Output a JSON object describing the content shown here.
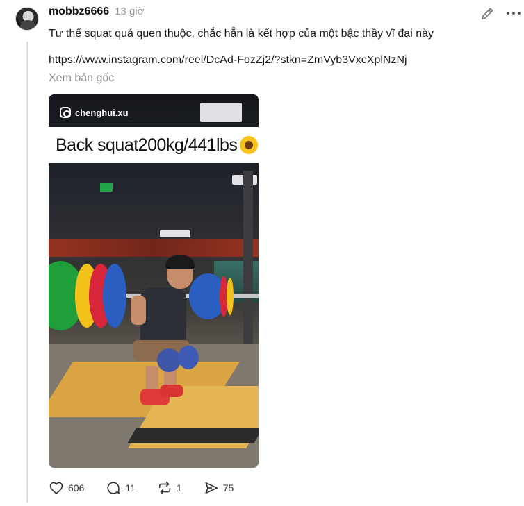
{
  "post": {
    "username": "mobbz6666",
    "time": "13 giờ",
    "text": "Tư thế squat quá quen thuộc, chắc hẳn là kết hợp của một bậc thầy vĩ đại này",
    "link": "https://www.instagram.com/reel/DcAd-FozZj2/?stkn=ZmVyb3VxcXplNzNj",
    "see_original": "Xem bản gốc"
  },
  "media": {
    "handle": "chenghui.xu_",
    "caption": "Back squat200kg/441lbs",
    "caption_emoji": "sunflower-icon"
  },
  "actions": {
    "likes": "606",
    "replies": "11",
    "reposts": "1",
    "shares": "75"
  },
  "icons": {
    "edit": "pencil-icon",
    "more": "more-dots-icon",
    "like": "heart-icon",
    "reply": "comment-bubble-icon",
    "repost": "repost-icon",
    "share": "send-icon"
  },
  "colors": {
    "text": "#1a1a1a",
    "muted": "#8e8e8e",
    "time": "#9a9a9a"
  }
}
